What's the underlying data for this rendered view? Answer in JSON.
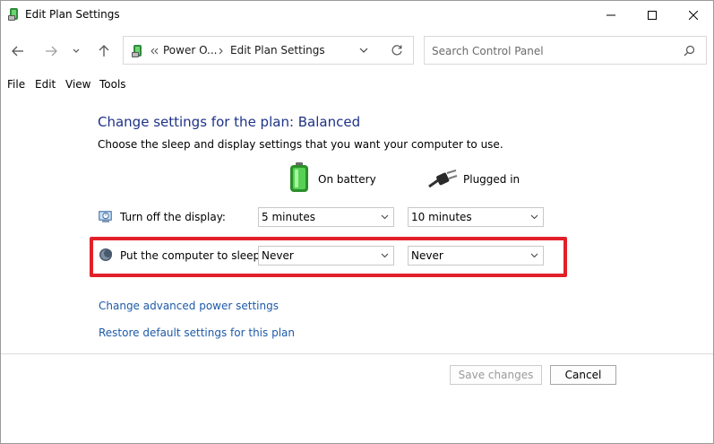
{
  "window": {
    "title": "Edit Plan Settings"
  },
  "address": {
    "segment1": "Power O...",
    "segment2": "Edit Plan Settings"
  },
  "search": {
    "placeholder": "Search Control Panel"
  },
  "menu": [
    "File",
    "Edit",
    "View",
    "Tools"
  ],
  "page": {
    "heading": "Change settings for the plan: Balanced",
    "subtext": "Choose the sleep and display settings that you want your computer to use.",
    "col_battery": "On battery",
    "col_plugged": "Plugged in",
    "rows": [
      {
        "label": "Turn off the display:",
        "battery": "5 minutes",
        "plugged": "10 minutes"
      },
      {
        "label": "Put the computer to sleep:",
        "battery": "Never",
        "plugged": "Never"
      }
    ],
    "link_advanced": "Change advanced power settings",
    "link_restore": "Restore default settings for this plan"
  },
  "buttons": {
    "save": "Save changes",
    "cancel": "Cancel"
  },
  "colors": {
    "heading": "#1e3287",
    "link": "#1e5aa8",
    "highlight": "#e2202a"
  }
}
